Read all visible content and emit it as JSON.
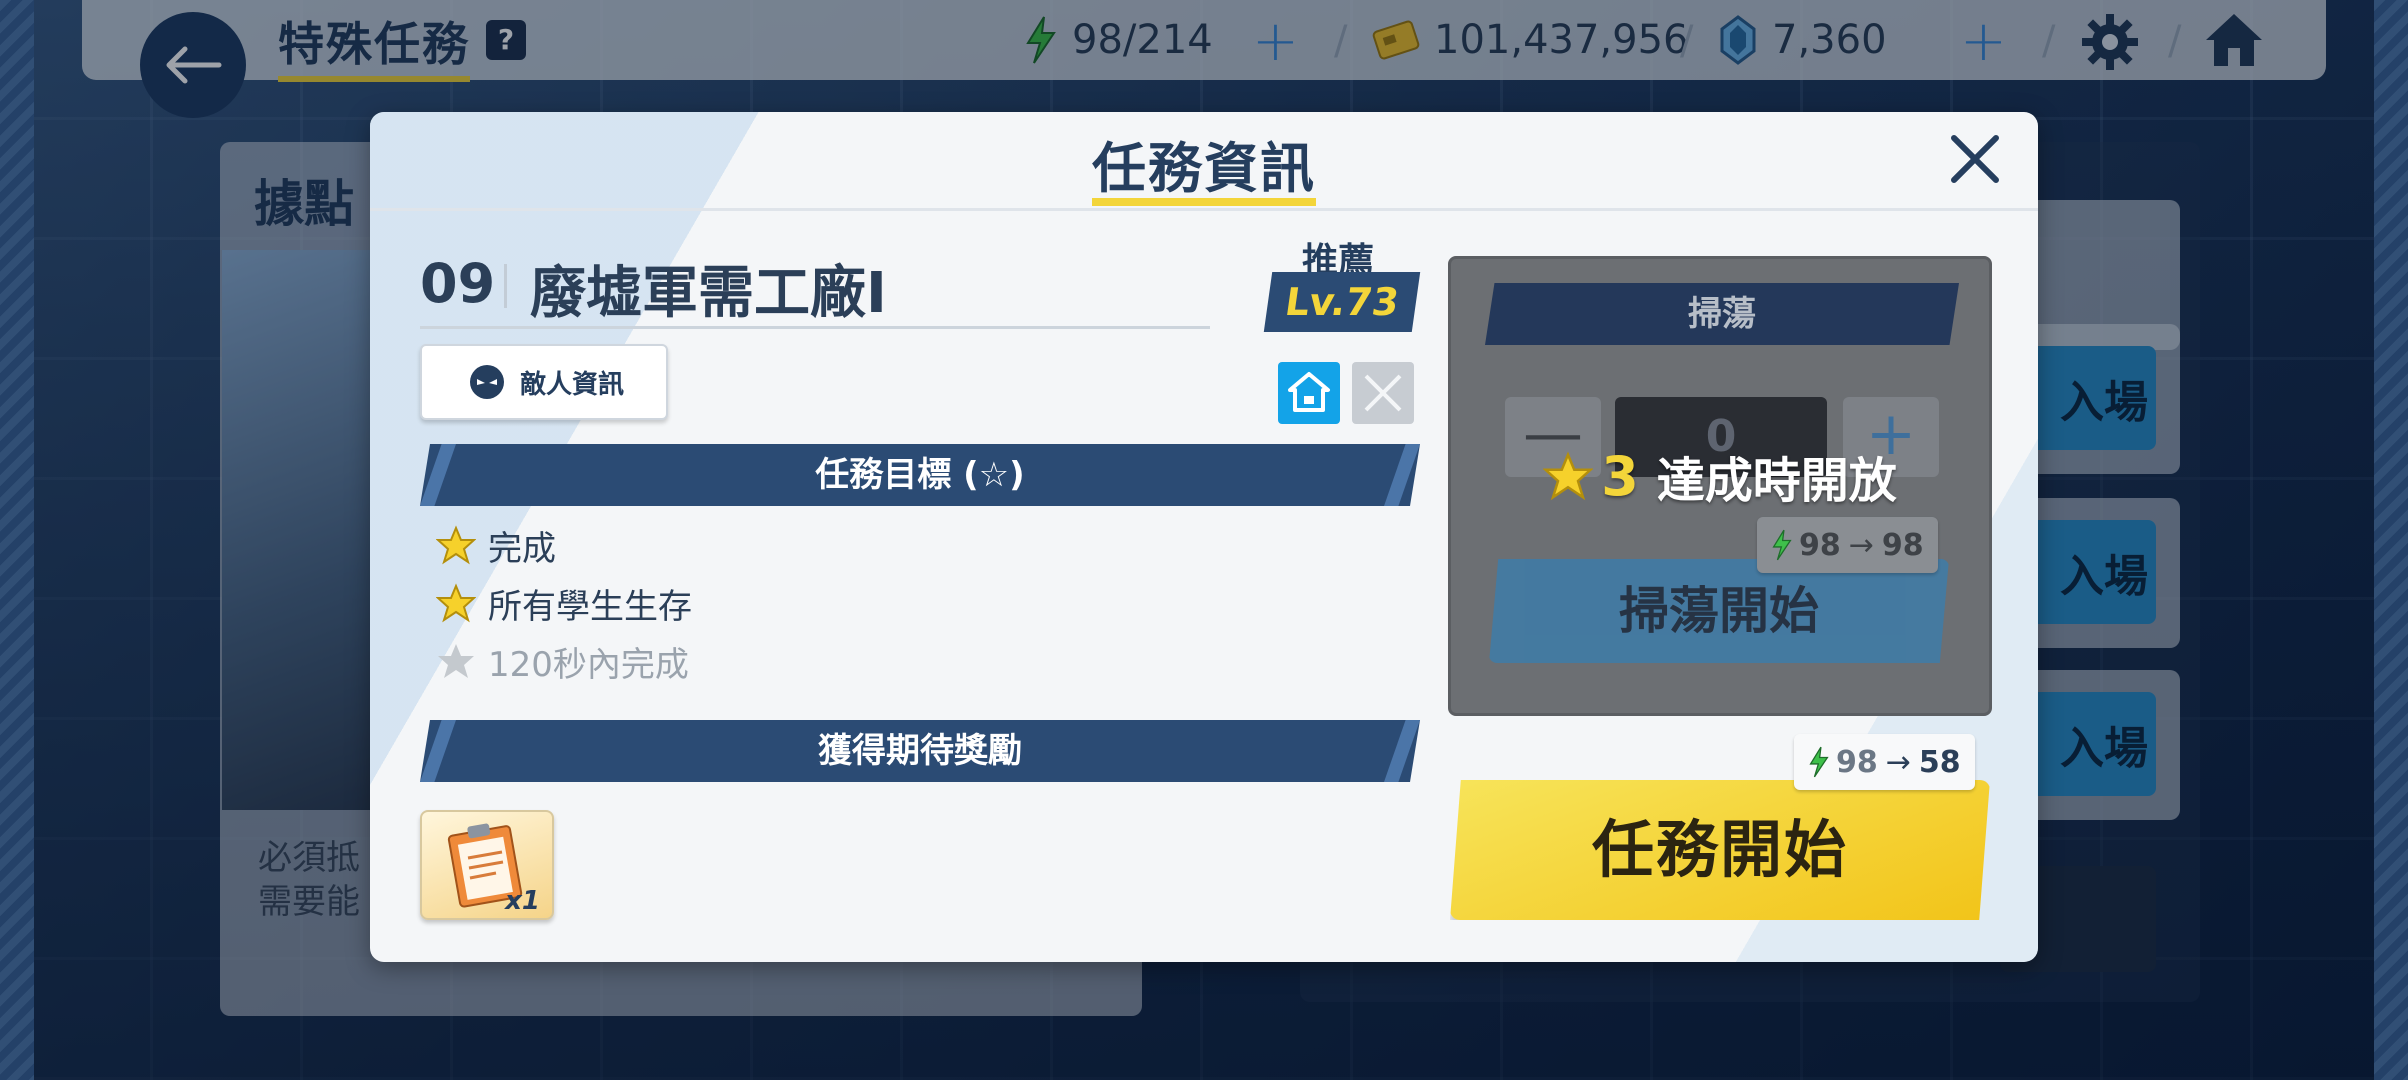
{
  "topbar": {
    "page_title": "特殊任務",
    "help_label": "?",
    "ap": "98/214",
    "credits": "101,437,956",
    "pyroxene": "7,360",
    "slash": "/"
  },
  "background": {
    "left_panel_title": "據點",
    "left_panel_text_1": "必須抵",
    "left_panel_text_2": "需要能",
    "entry_label": "入場"
  },
  "modal": {
    "title": "任務資訊",
    "stage_number": "09",
    "stage_name": "廢墟軍需工廠I",
    "recommended_label": "推薦",
    "recommended_level": "Lv.73",
    "enemy_info_label": "敵人資訊",
    "objectives_header": "任務目標 (☆)",
    "objectives": [
      {
        "text": "完成",
        "achieved": true
      },
      {
        "text": "所有學生生存",
        "achieved": true
      },
      {
        "text": "120秒內完成",
        "achieved": false
      }
    ],
    "rewards_header": "獲得期待獎勵",
    "reward_item": {
      "icon": "report-clipboard-icon",
      "quantity": "x1"
    }
  },
  "sweep": {
    "header": "掃蕩",
    "count": "0",
    "minus_label": "—",
    "plus_label": "+",
    "lock_stars": "3",
    "lock_message": "達成時開放",
    "ap_from": "98",
    "ap_to": "98",
    "start_label": "掃蕩開始"
  },
  "start": {
    "ap_from": "98",
    "ap_to": "58",
    "label": "任務開始"
  },
  "colors": {
    "accent_yellow": "#f3d53a",
    "navy": "#253e5e",
    "band": "#2b4b74",
    "ap_green": "#3ec04a"
  }
}
